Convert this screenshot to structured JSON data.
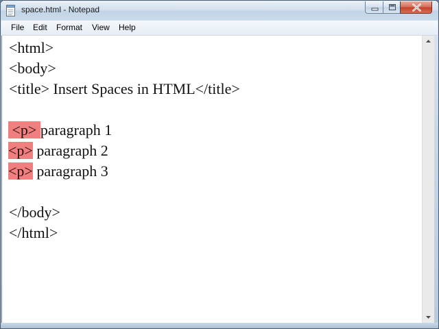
{
  "window": {
    "title": "space.html - Notepad",
    "app_icon": "notepad-icon"
  },
  "title_buttons": {
    "minimize_icon": "minimize-icon",
    "maximize_icon": "maximize-icon",
    "close_icon": "close-icon"
  },
  "menu": {
    "items": [
      {
        "label": "File"
      },
      {
        "label": "Edit"
      },
      {
        "label": "Format"
      },
      {
        "label": "View"
      },
      {
        "label": "Help"
      }
    ]
  },
  "editor": {
    "highlight_color": "#f08080",
    "lines": [
      {
        "text": "<html>"
      },
      {
        "text": "<body>"
      },
      {
        "text": "<title> Insert Spaces in HTML</title>"
      },
      {
        "text": ""
      },
      {
        "tag": " <p> ",
        "text": "paragraph 1"
      },
      {
        "tag": "<p>",
        "text": " paragraph 2"
      },
      {
        "tag": "<p>",
        "text": " paragraph 3"
      },
      {
        "text": ""
      },
      {
        "text": "</body>"
      },
      {
        "text": "</html>"
      }
    ]
  },
  "scrollbar": {
    "up_icon": "scroll-up-arrow-icon",
    "down_icon": "scroll-down-arrow-icon"
  }
}
